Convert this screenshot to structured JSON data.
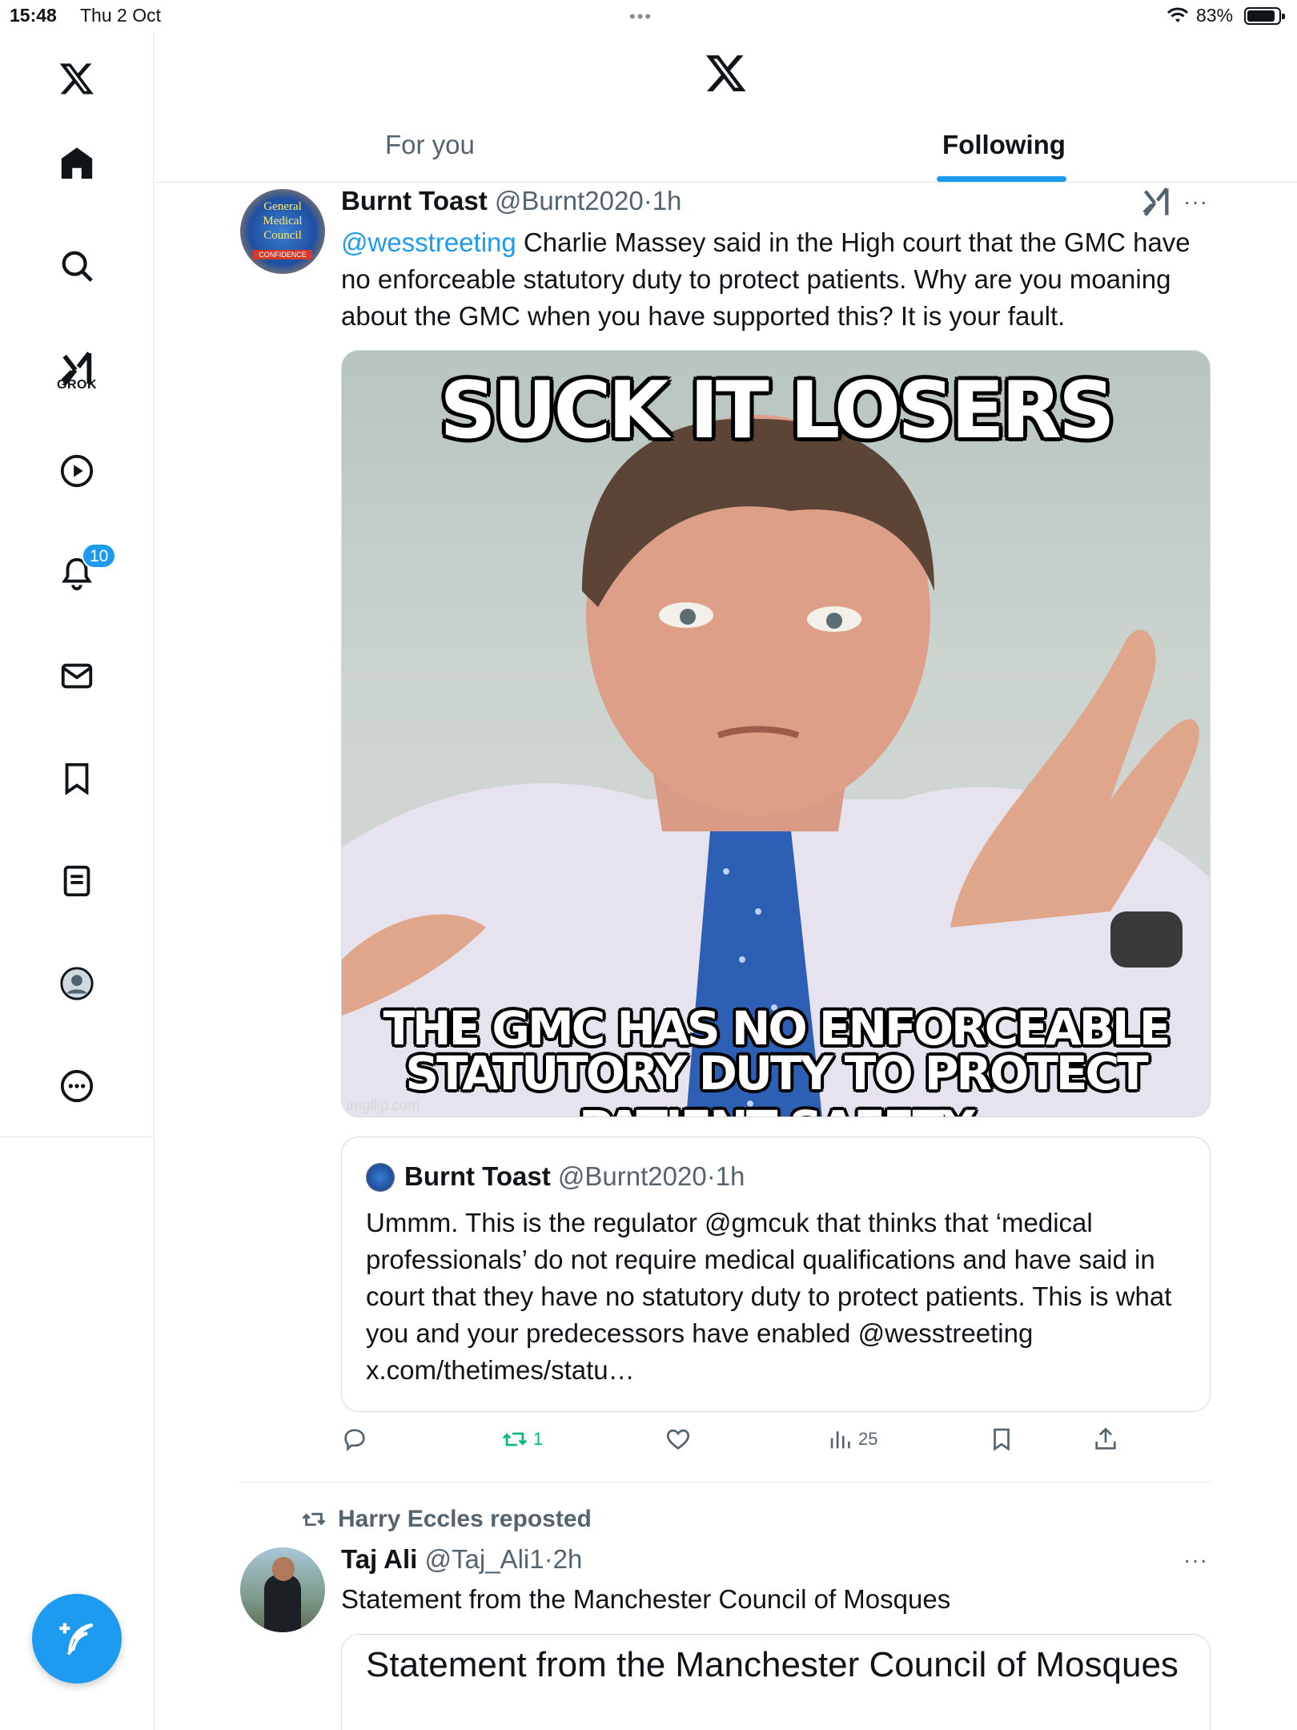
{
  "status_bar": {
    "time": "15:48",
    "date": "Thu 2 Oct",
    "battery": "83%"
  },
  "sidebar": {
    "grok_label": "GROK",
    "notifications_badge": "10"
  },
  "tabs": {
    "for_you": "For you",
    "following": "Following"
  },
  "tweet1": {
    "name": "Burnt Toast",
    "handle": "@Burnt2020",
    "dot": "·",
    "time": "1h",
    "mention": "@wesstreeting",
    "text": " Charlie Massey said in the High court that the GMC have no enforceable statutory duty to protect patients. Why are you moaning about the GMC when you have supported this? It is your fault.",
    "avatar_text": [
      "General",
      "Medical",
      "Council"
    ],
    "avatar_banner": "CONFIDENCE",
    "media": {
      "top_caption": "SUCK IT LOSERS",
      "bottom_line1": "THE GMC HAS NO ENFORCEABLE",
      "bottom_line2": "STATUTORY DUTY TO PROTECT PATIENT SAFETY",
      "watermark": "imgflip.com"
    },
    "quote": {
      "name": "Burnt Toast",
      "handle": "@Burnt2020",
      "dot": "·",
      "time": "1h",
      "text": "Ummm. This is the regulator @gmcuk that thinks that ‘medical professionals’ do not require medical qualifications and have said in court that they have no statutory duty to protect patients. This is what you and your predecessors have enabled @wesstreeting x.com/thetimes/statu…"
    },
    "actions": {
      "retweets": "1",
      "views": "25"
    }
  },
  "tweet2": {
    "repost_label": "Harry Eccles reposted",
    "name": "Taj Ali",
    "handle": "@Taj_Ali1",
    "dot": "·",
    "time": "2h",
    "text": "Statement from the Manchester Council of Mosques",
    "card_title": "Statement from the Manchester Council of Mosques"
  },
  "colors": {
    "accent": "#1d9bf0",
    "secondary_text": "#536471",
    "retweet_green": "#00ba7c"
  },
  "icons": [
    "x-logo-icon",
    "home-icon",
    "search-icon",
    "grok-icon",
    "video-icon",
    "bell-icon",
    "mail-icon",
    "bookmark-icon",
    "lists-icon",
    "profile-icon",
    "more-circle-icon",
    "compose-icon",
    "reply-icon",
    "retweet-icon",
    "like-icon",
    "views-icon",
    "share-icon",
    "more-icon"
  ]
}
